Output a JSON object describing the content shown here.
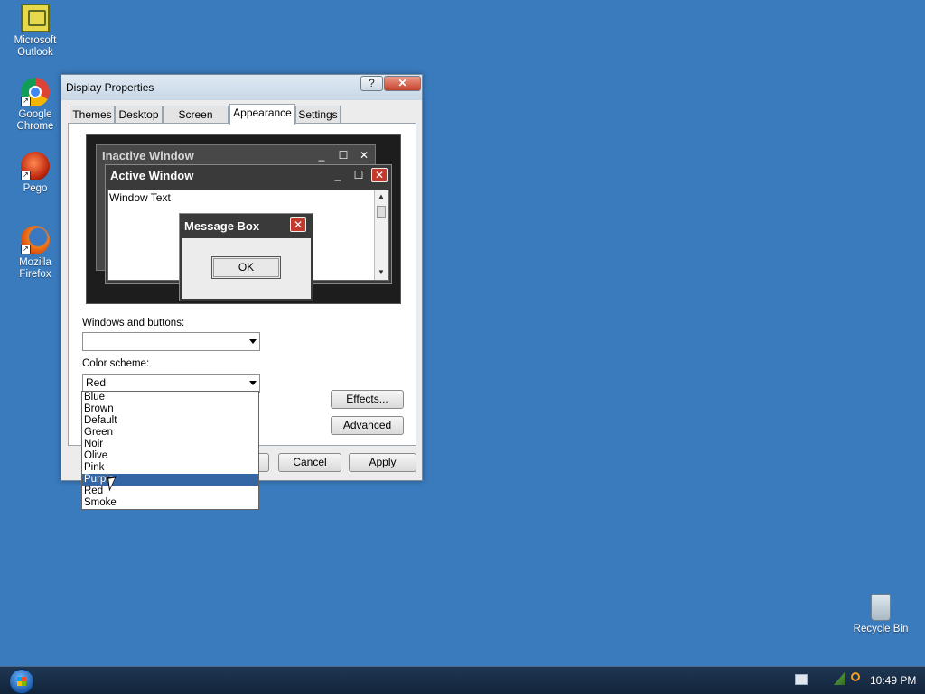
{
  "desktop": {
    "icons": [
      {
        "label_line1": "Microsoft",
        "label_line2": "Outlook"
      },
      {
        "label_line1": "Google",
        "label_line2": "Chrome"
      },
      {
        "label_line1": "Pego",
        "label_line2": ""
      },
      {
        "label_line1": "Mozilla",
        "label_line2": "Firefox"
      },
      {
        "label_line1": "Recycle Bin",
        "label_line2": ""
      }
    ]
  },
  "dialog": {
    "title": "Display Properties",
    "help_label": "?",
    "close_label": "✕",
    "tabs": [
      "Themes",
      "Desktop",
      "Screen Saver",
      "Appearance",
      "Settings"
    ],
    "active_tab": "Appearance",
    "preview": {
      "inactive_title": "Inactive Window",
      "active_title": "Active Window",
      "window_text": "Window Text",
      "message_title": "Message Box",
      "ok_label": "OK"
    },
    "windows_buttons_label": "Windows and buttons:",
    "windows_buttons_value": "",
    "color_scheme_label": "Color scheme:",
    "color_scheme_value": "Red",
    "color_scheme_options": [
      "Blue",
      "Brown",
      "Default",
      "Green",
      "Noir",
      "Olive",
      "Pink",
      "Purple",
      "Red",
      "Smoke"
    ],
    "highlighted_option": "Purple",
    "effects_label": "Effects...",
    "advanced_label": "Advanced",
    "cancel_label": "Cancel",
    "apply_label": "Apply"
  },
  "taskbar": {
    "clock": "10:49 PM"
  },
  "colors": {
    "desktop": "#3a7bbd",
    "selection": "#3465a4",
    "taskbar": "#1f3753"
  }
}
